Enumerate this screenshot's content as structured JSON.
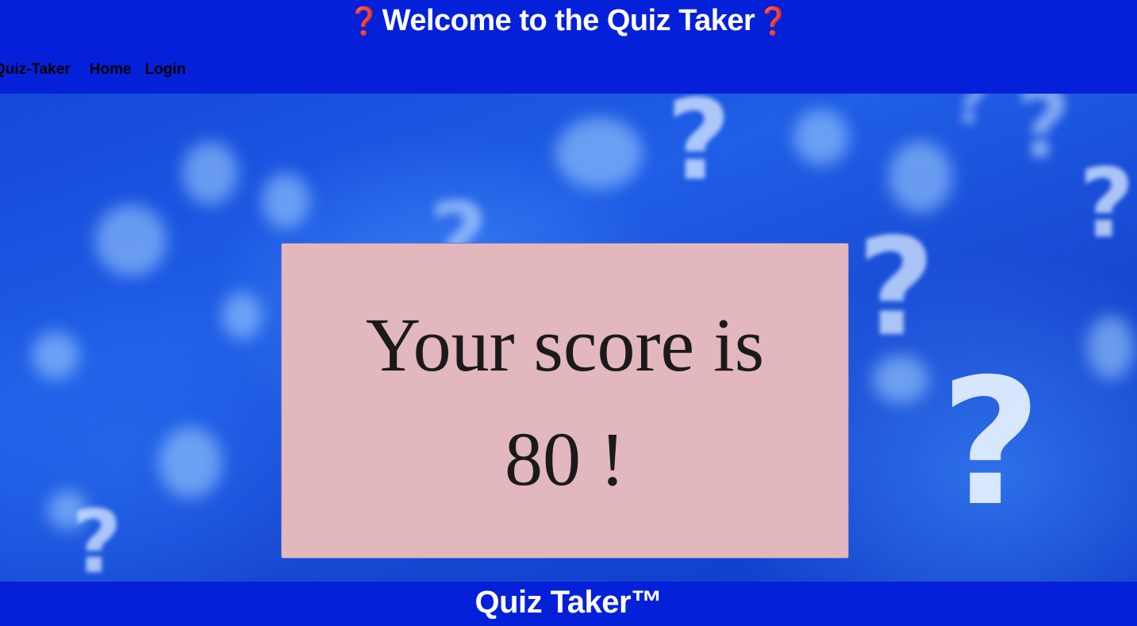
{
  "header": {
    "title": "Welcome to the Quiz Taker",
    "icon_left": "❓",
    "icon_right": "❓"
  },
  "nav": {
    "brand": "Quiz-Taker",
    "items": [
      {
        "label": "Home"
      },
      {
        "label": "Login"
      }
    ]
  },
  "result": {
    "line1": "Your score is",
    "line2": "80 !"
  },
  "footer": {
    "text": "Quiz Taker™"
  },
  "colors": {
    "header_bg": "#0420d9",
    "card_bg": "#e2b7bd",
    "question_icon": "#e0202a"
  }
}
